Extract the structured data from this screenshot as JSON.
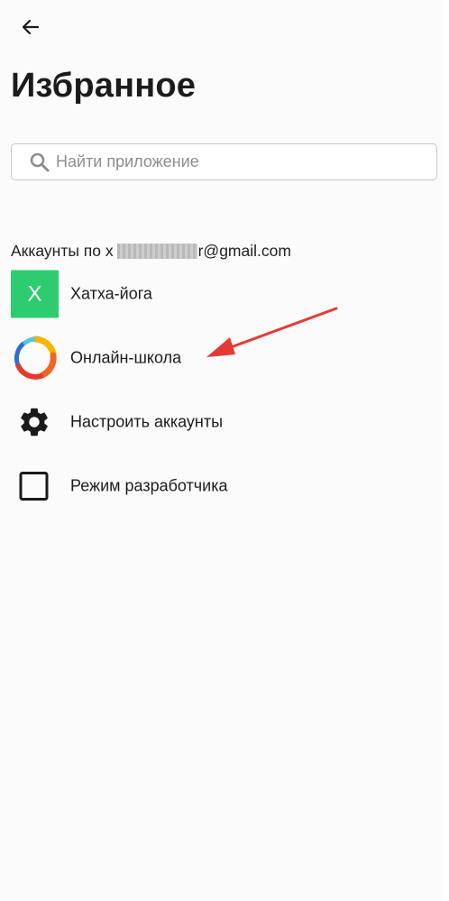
{
  "header": {
    "title": "Избранное",
    "back_icon": "arrow-left-icon"
  },
  "search": {
    "placeholder": "Найти приложение",
    "value": "",
    "icon": "search-icon"
  },
  "accounts_section": {
    "prefix": "Аккаунты по",
    "visible_letter": "x",
    "suffix": "r@gmail.com",
    "redacted": true
  },
  "list": {
    "items": [
      {
        "label": "Хатха-йога",
        "icon": "letter-avatar",
        "avatar_letter": "X",
        "avatar_color": "#2ecc71"
      },
      {
        "label": "Онлайн-школа",
        "icon": "colorful-ring-logo"
      },
      {
        "label": "Настроить аккаунты",
        "icon": "gear-icon"
      },
      {
        "label": "Режим разработчика",
        "icon": "checkbox-icon",
        "checked": false
      }
    ]
  },
  "annotation": {
    "type": "arrow",
    "color": "#e53935",
    "points_to": "Онлайн-школа"
  },
  "colors": {
    "background": "#fbfbfb",
    "text": "#1c1c1c",
    "accent_green": "#2ecc71",
    "annotation_red": "#e53935"
  }
}
